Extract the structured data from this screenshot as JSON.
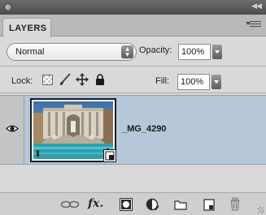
{
  "panel": {
    "tab_label": "LAYERS",
    "blend_mode": {
      "value": "Normal"
    },
    "opacity": {
      "label": "Opacity:",
      "value": "100%"
    },
    "lock": {
      "label": "Lock:",
      "icons": [
        "lock-transparent-pixels-icon",
        "lock-image-pixels-icon",
        "lock-position-icon",
        "lock-all-icon"
      ]
    },
    "fill": {
      "label": "Fill:",
      "value": "100%"
    },
    "layers": [
      {
        "name": "_MG_4290",
        "visible": true,
        "selected": true,
        "thumbnail": "trevi-fountain-photo",
        "smart_object": true
      }
    ],
    "footer": {
      "buttons": [
        "link-layers-icon",
        "add-layer-style-icon",
        "add-layer-mask-icon",
        "new-adjustment-layer-icon",
        "new-group-icon",
        "new-layer-icon",
        "delete-layer-icon"
      ],
      "fx_label": "fx."
    }
  },
  "colors": {
    "panel_bg": "#d9d9d9",
    "titlebar": "#5b5b5b",
    "selected_row": "#b5c7d9"
  }
}
